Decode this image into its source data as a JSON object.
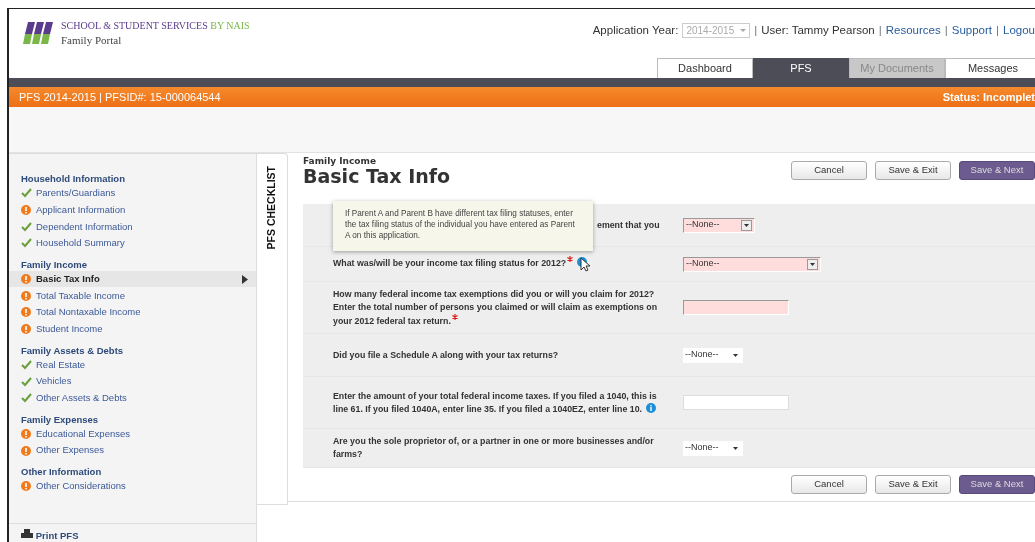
{
  "header": {
    "logo_title": "SCHOOL & STUDENT SERVICES",
    "logo_by": "BY NAIS",
    "logo_subtitle": "Family Portal",
    "top_bar": [
      {
        "kind": "label",
        "text": "Application Year:"
      },
      {
        "kind": "select",
        "text": "2014-2015",
        "disabled": true
      },
      {
        "kind": "sep",
        "text": "|"
      },
      {
        "kind": "text",
        "text": "User: Tammy Pearson"
      },
      {
        "kind": "sep",
        "text": "|"
      },
      {
        "kind": "link",
        "text": "Resources"
      },
      {
        "kind": "sep",
        "text": "|"
      },
      {
        "kind": "link",
        "text": "Support"
      },
      {
        "kind": "sep",
        "text": "|"
      },
      {
        "kind": "link",
        "text": "Logou"
      }
    ]
  },
  "tabs": [
    {
      "label": "Dashboard",
      "selected": false,
      "disabled": false
    },
    {
      "label": "PFS",
      "selected": true,
      "disabled": false
    },
    {
      "label": "My Documents",
      "selected": false,
      "disabled": true
    },
    {
      "label": "Messages",
      "selected": false,
      "disabled": false
    }
  ],
  "pfs_bar": {
    "title": "PFS 2014-2015 | PFSID#: 15-000064544",
    "status": "Status: Incomplet"
  },
  "sidebar": {
    "tab_label": "PFS CHECKLIST",
    "sections": [
      {
        "title": "Household Information",
        "items": [
          {
            "label": "Parents/Guardians",
            "complete": true,
            "selected": false
          },
          {
            "label": "Applicant Information",
            "complete": false,
            "selected": false
          },
          {
            "label": "Dependent Information",
            "complete": true,
            "selected": false
          },
          {
            "label": "Household Summary",
            "complete": true,
            "selected": false
          }
        ]
      },
      {
        "title": "Family Income",
        "items": [
          {
            "label": "Basic Tax Info",
            "complete": false,
            "selected": true
          },
          {
            "label": "Total Taxable Income",
            "complete": false,
            "selected": false
          },
          {
            "label": "Total Nontaxable Income",
            "complete": false,
            "selected": false
          },
          {
            "label": "Student Income",
            "complete": false,
            "selected": false
          }
        ]
      },
      {
        "title": "Family Assets & Debts",
        "items": [
          {
            "label": "Real Estate",
            "complete": true,
            "selected": false
          },
          {
            "label": "Vehicles",
            "complete": true,
            "selected": false
          },
          {
            "label": "Other Assets & Debts",
            "complete": true,
            "selected": false
          }
        ]
      },
      {
        "title": "Family Expenses",
        "items": [
          {
            "label": "Educational Expenses",
            "complete": false,
            "selected": false
          },
          {
            "label": "Other Expenses",
            "complete": false,
            "selected": false
          }
        ]
      },
      {
        "title": "Other Information",
        "items": [
          {
            "label": "Other Considerations",
            "complete": false,
            "selected": false
          }
        ]
      }
    ],
    "print_label": "Print PFS"
  },
  "page": {
    "section": "Family Income",
    "title": "Basic Tax Info",
    "top_buttons": [
      {
        "label": "Cancel",
        "kind": "secondary"
      },
      {
        "label": "Save & Exit",
        "kind": "secondary"
      },
      {
        "label": "Save & Next",
        "kind": "primary"
      }
    ],
    "bottom_buttons": [
      {
        "label": "Cancel",
        "kind": "secondary"
      },
      {
        "label": "Save & Exit",
        "kind": "secondary"
      },
      {
        "label": "Save & Next",
        "kind": "primary"
      }
    ]
  },
  "tooltip": "If Parent A and Parent B have different tax filing statuses, enter the tax filing status of the individual you have entered as Parent A on this application.",
  "questions": [
    {
      "text": "ement that you",
      "required": false,
      "info": false,
      "field": {
        "kind": "select",
        "value": "--None--",
        "invalid": true
      }
    },
    {
      "text": "What was/will be your income tax filing status for 2012?",
      "required": true,
      "info": true,
      "field": {
        "kind": "select",
        "value": "--None--",
        "invalid": true
      }
    },
    {
      "text": "How many federal income tax exemptions did you or will you claim for 2012? Enter the total number of persons you claimed or will claim as exemptions on your 2012 federal tax return.",
      "required": true,
      "info": false,
      "field": {
        "kind": "text",
        "invalid": true
      }
    },
    {
      "text": "Did you file a Schedule A along with your tax returns?",
      "required": false,
      "info": false,
      "field": {
        "kind": "select",
        "value": "--None--",
        "invalid": false
      }
    },
    {
      "text": "Enter the amount of your total federal income taxes. If you filed a 1040, this is line 61. If you filed 1040A, enter line 35. If you filed a 1040EZ, enter line 10.",
      "required": false,
      "info": true,
      "field": {
        "kind": "text",
        "invalid": false
      }
    },
    {
      "text": "Are you the sole proprietor of, or a partner in one or more businesses and/or farms?",
      "required": false,
      "info": false,
      "field": {
        "kind": "select",
        "value": "--None--",
        "invalid": false
      }
    }
  ]
}
